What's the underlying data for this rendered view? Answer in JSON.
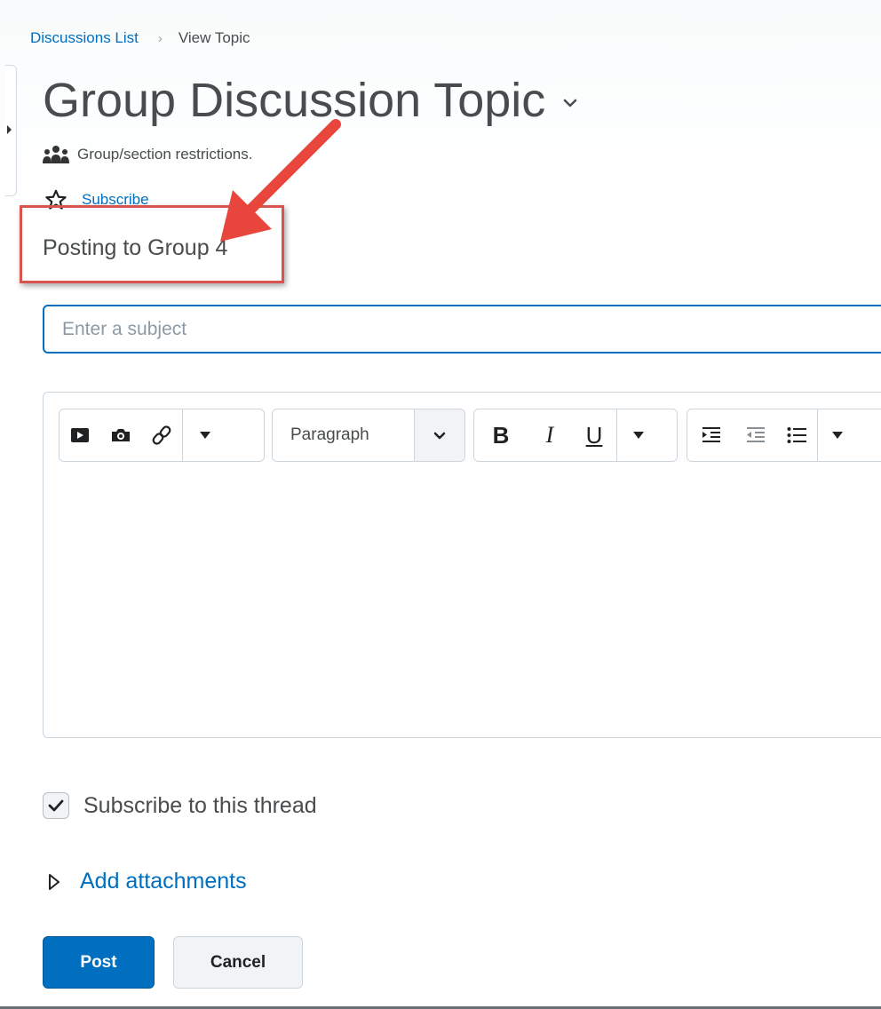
{
  "breadcrumb": {
    "link": "Discussions List",
    "separator": "›",
    "current": "View Topic"
  },
  "header": {
    "title": "Group Discussion Topic",
    "restriction": "Group/section restrictions.",
    "subscribe_label": "Subscribe"
  },
  "callout": {
    "text": "Posting to Group 4",
    "color": "#d9534f"
  },
  "form": {
    "subject_placeholder": "Enter a subject",
    "subject_value": ""
  },
  "toolbar": {
    "format_select": "Paragraph",
    "bold": "B",
    "italic": "I",
    "underline": "U"
  },
  "options": {
    "subscribe_thread_label": "Subscribe to this thread",
    "subscribe_thread_checked": true,
    "add_attachments_label": "Add attachments"
  },
  "actions": {
    "post_label": "Post",
    "cancel_label": "Cancel"
  },
  "colors": {
    "link": "#006fbf",
    "primary_button": "#006fbf",
    "annotation_red": "#d9534f"
  }
}
